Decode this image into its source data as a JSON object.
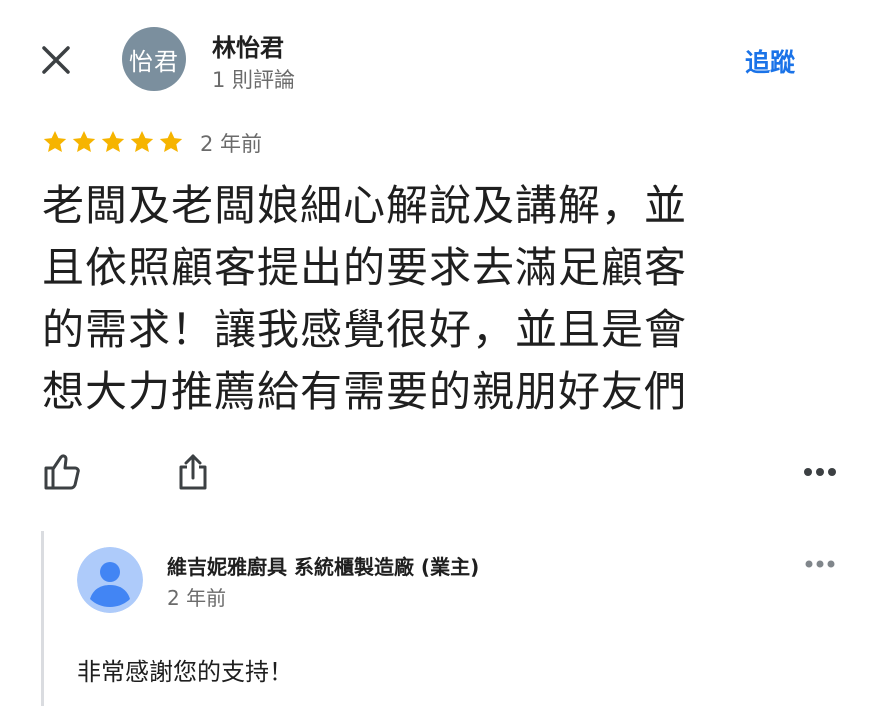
{
  "header": {
    "close_icon": "close-icon",
    "avatar_initials": "怡君",
    "avatar_color": "#7b8f9e",
    "author_name": "林怡君",
    "review_count": "1 則評論",
    "follow_label": "追蹤",
    "accent_color": "#1a73e8"
  },
  "review": {
    "rating": 5,
    "star_color": "#f6b400",
    "time": "2 年前",
    "lines": [
      "老闆及老闆娘細心解說及講解，並",
      "且依照顧客提出的要求去滿足顧客",
      "的需求！讓我感覺很好，並且是會",
      "想大力推薦給有需要的親朋好友們"
    ]
  },
  "actions": {
    "like_icon": "thumbs-up-icon",
    "share_icon": "share-icon",
    "more_icon": "more-horizontal-icon"
  },
  "owner_reply": {
    "name": "維吉妮雅廚具 系統櫃製造廠 (業主)",
    "time": "2 年前",
    "text": "非常感謝您的支持！",
    "avatar_icon": "person-icon",
    "avatar_color": "#aecbfa",
    "more_icon": "more-horizontal-icon"
  }
}
